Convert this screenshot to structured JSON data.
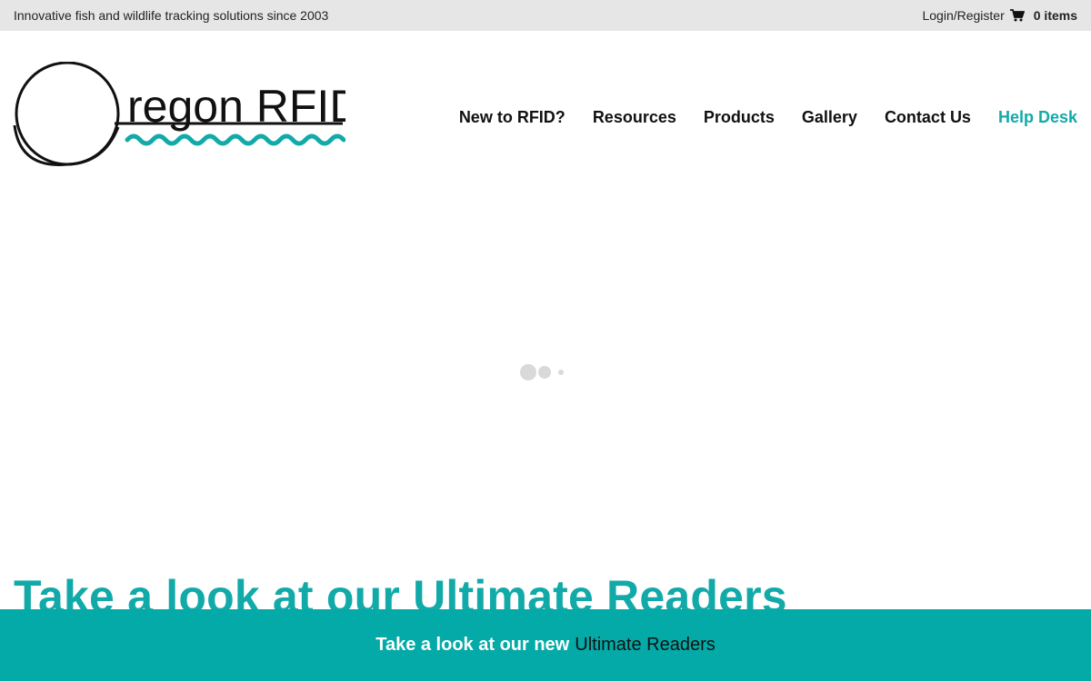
{
  "topbar": {
    "tagline": "Innovative fish and wildlife tracking solutions since 2003",
    "login_label": "Login/Register",
    "cart_icon": "shopping-cart-icon",
    "cart_count": "0 items"
  },
  "logo": {
    "text": "regon RFID",
    "initial": "O"
  },
  "nav": {
    "items": [
      {
        "label": "New to RFID?"
      },
      {
        "label": "Resources"
      },
      {
        "label": "Products"
      },
      {
        "label": "Gallery"
      },
      {
        "label": "Contact Us"
      },
      {
        "label": "Help Desk"
      }
    ]
  },
  "hero": {
    "title": "Take a look at our Ultimate Readers"
  },
  "banner": {
    "text": "Take a look at our new",
    "link": "Ultimate Readers"
  },
  "colors": {
    "accent": "#12aaa8",
    "banner": "#04aaa7",
    "topbar": "#e6e6e6"
  }
}
